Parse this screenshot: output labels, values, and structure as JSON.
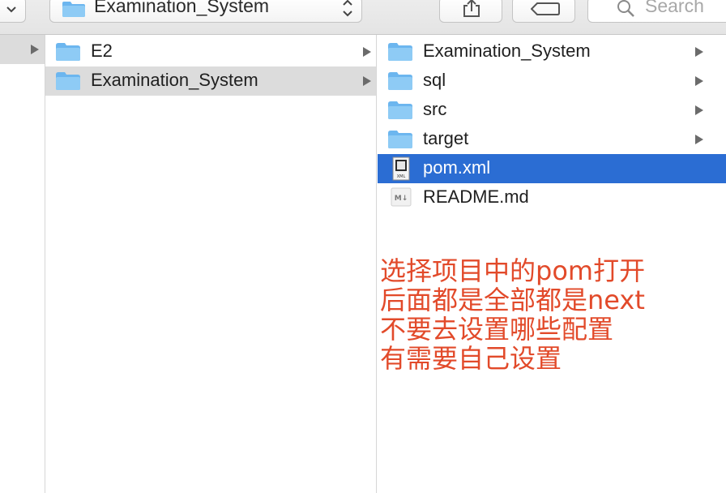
{
  "toolbar": {
    "path_label": "Examination_System",
    "search_placeholder": "Search"
  },
  "columns": [
    {
      "items": [
        {
          "label": "E2",
          "kind": "folder",
          "has_children": true,
          "selected": false
        },
        {
          "label": "Examination_System",
          "kind": "folder",
          "has_children": true,
          "selected": true
        }
      ]
    },
    {
      "items": [
        {
          "label": "Examination_System",
          "kind": "folder",
          "has_children": true
        },
        {
          "label": "sql",
          "kind": "folder",
          "has_children": true
        },
        {
          "label": "src",
          "kind": "folder",
          "has_children": true
        },
        {
          "label": "target",
          "kind": "folder",
          "has_children": true
        },
        {
          "label": "pom.xml",
          "kind": "xml-file",
          "has_children": false,
          "selected": true
        },
        {
          "label": "README.md",
          "kind": "markdown-file",
          "has_children": false
        }
      ]
    }
  ],
  "annotation": {
    "lines": [
      "选择项目中的pom打开",
      "后面都是全部都是next",
      "不要去设置哪些配置",
      "有需要自己设置"
    ],
    "color": "#e24a2a"
  },
  "colors": {
    "selection_blue": "#2b6dd3",
    "selection_gray": "#dcdcdc",
    "folder_blue": "#6cb6ef"
  }
}
